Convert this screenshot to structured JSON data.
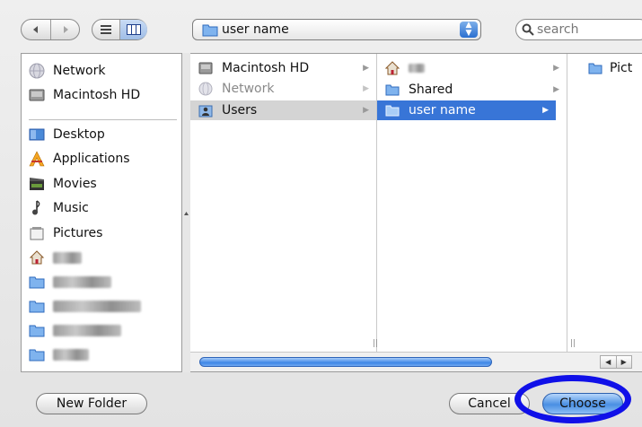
{
  "toolbar": {
    "back_icon": "back-arrow-icon",
    "forward_icon": "forward-arrow-icon",
    "list_view_icon": "list-view-icon",
    "column_view_icon": "column-view-icon",
    "path_popup": {
      "label": "user name",
      "icon": "folder-icon",
      "stepper_icon": "popup-stepper-icon"
    },
    "search": {
      "placeholder": "search",
      "icon": "magnifier-icon"
    }
  },
  "sidebar": {
    "devices": [
      {
        "label": "Network",
        "icon": "network-globe-icon"
      },
      {
        "label": "Macintosh HD",
        "icon": "hard-drive-icon"
      }
    ],
    "places": [
      {
        "label": "Desktop",
        "icon": "desktop-icon"
      },
      {
        "label": "Applications",
        "icon": "applications-icon"
      },
      {
        "label": "Movies",
        "icon": "movies-icon"
      },
      {
        "label": "Music",
        "icon": "music-icon"
      },
      {
        "label": "Pictures",
        "icon": "pictures-icon"
      },
      {
        "label": "",
        "icon": "home-icon",
        "blurred": true
      },
      {
        "label": "",
        "icon": "folder-icon",
        "blurred": true
      },
      {
        "label": "",
        "icon": "folder-icon",
        "blurred": true
      },
      {
        "label": "",
        "icon": "folder-icon",
        "blurred": true
      },
      {
        "label": "",
        "icon": "folder-icon",
        "blurred": true
      }
    ]
  },
  "browser": {
    "column1": [
      {
        "label": "Macintosh HD",
        "icon": "hard-drive-icon",
        "dimmed": false
      },
      {
        "label": "Network",
        "icon": "network-globe-icon",
        "dimmed": true
      },
      {
        "label": "Users",
        "icon": "users-icon",
        "selected": "inactive"
      }
    ],
    "column2": [
      {
        "label": "",
        "icon": "home-icon",
        "blurred": true
      },
      {
        "label": "Shared",
        "icon": "folder-icon"
      },
      {
        "label": "user name",
        "icon": "folder-icon",
        "selected": "active"
      }
    ],
    "column3": [
      {
        "label": "Pict",
        "icon": "folder-icon"
      }
    ],
    "column_arrow": "▶",
    "resize_handle": "||"
  },
  "buttons": {
    "new_folder": "New Folder",
    "cancel": "Cancel",
    "choose": "Choose"
  },
  "colors": {
    "selection_active": "#3875d7",
    "selection_inactive": "#d4d4d4",
    "highlight_ring": "#1010e8"
  }
}
